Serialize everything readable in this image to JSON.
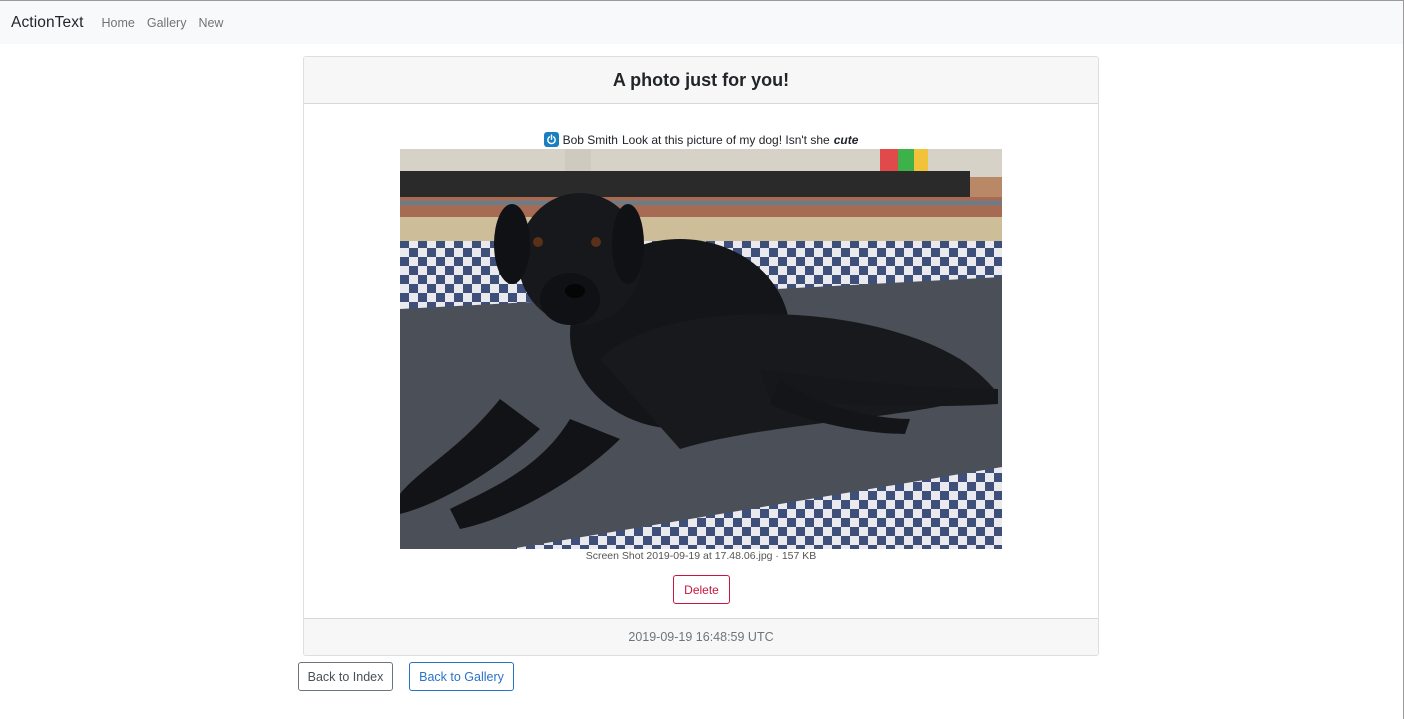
{
  "navbar": {
    "brand": "ActionText",
    "links": [
      "Home",
      "Gallery",
      "New"
    ]
  },
  "card": {
    "title": "A photo just for you!",
    "mention": {
      "name": "Bob Smith",
      "icon": "power-icon"
    },
    "text": "Look at this picture of my dog! Isn't she",
    "emphasis": "cute",
    "photo": {
      "subject": "dog-photo"
    },
    "caption": "Screen Shot 2019-09-19 at 17.48.06.jpg · 157 KB",
    "delete_label": "Delete",
    "timestamp": "2019-09-19 16:48:59 UTC"
  },
  "actions": {
    "back_index": "Back to Index",
    "back_gallery": "Back to Gallery"
  },
  "colors": {
    "danger": "#c6173f",
    "primary": "#2a72c8",
    "secondary": "#6c757d",
    "navbar_bg": "#f8f9fa"
  }
}
